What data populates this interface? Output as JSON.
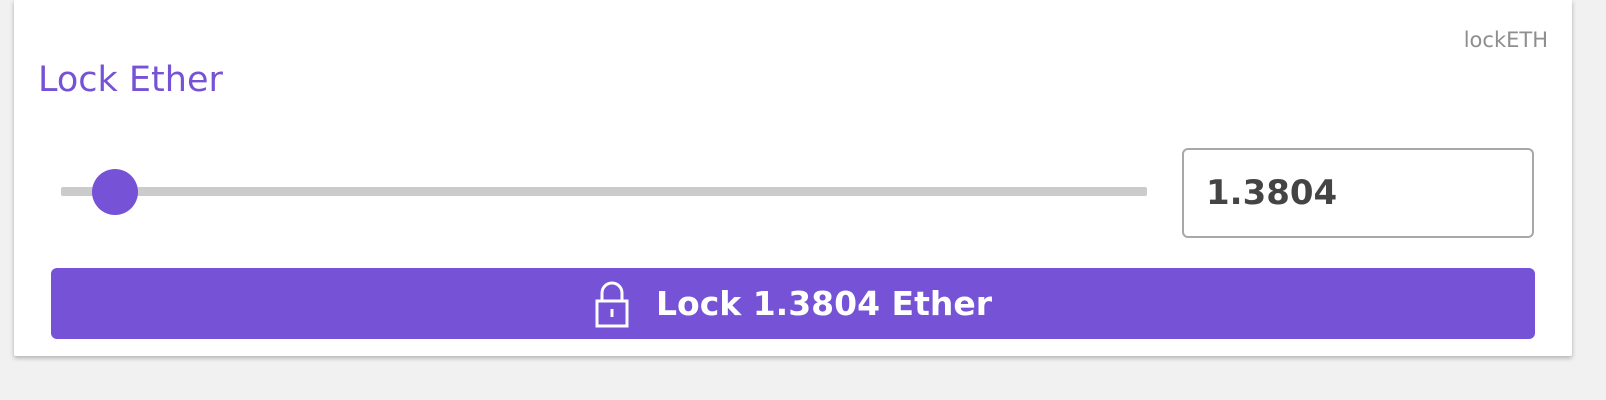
{
  "card": {
    "corner_label": "lockETH",
    "title": "Lock Ether"
  },
  "slider": {
    "value": 1.3804,
    "fraction": 0.03
  },
  "amount_input": {
    "value": "1.3804"
  },
  "lock_button": {
    "icon": "lock-icon",
    "label": "Lock 1.3804 Ether"
  },
  "colors": {
    "accent": "#7652d6",
    "track": "#cbcbcb",
    "background": "#f1f1f1"
  }
}
